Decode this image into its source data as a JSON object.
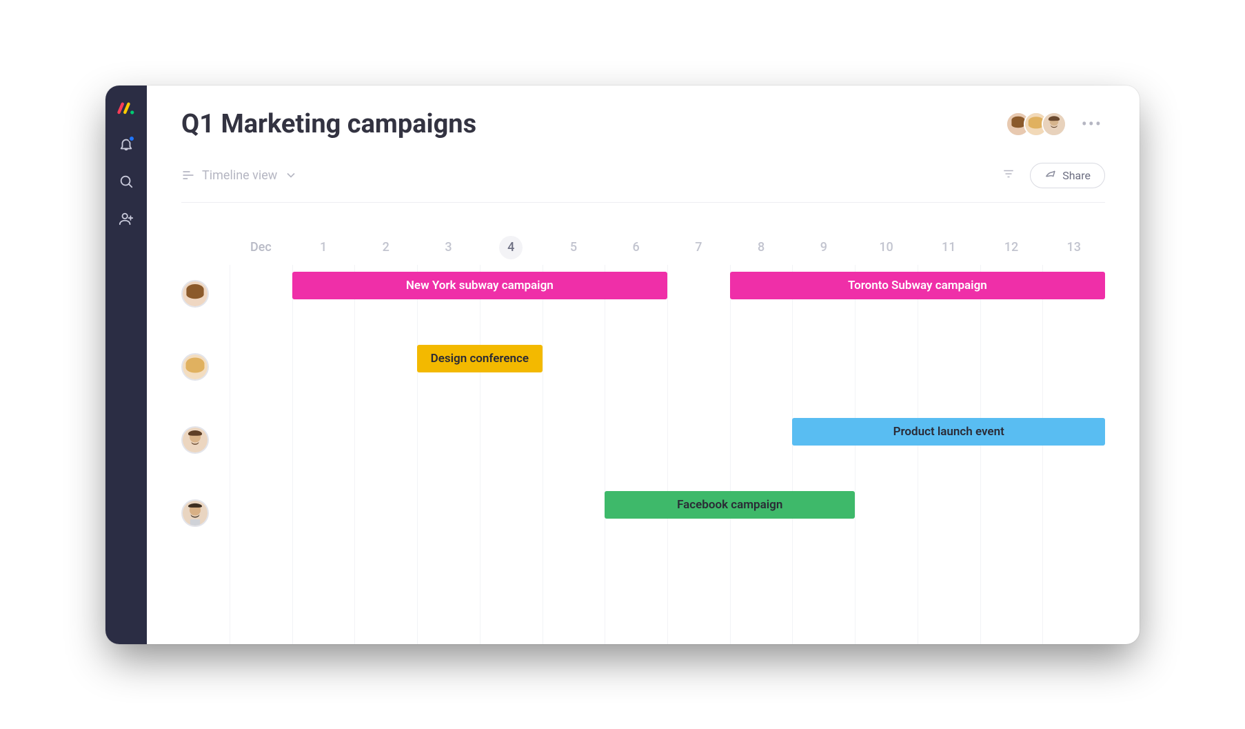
{
  "header": {
    "title": "Q1 Marketing campaigns",
    "share_label": "Share",
    "view_label": "Timeline view"
  },
  "timeline": {
    "month_label": "Dec",
    "days": [
      "1",
      "2",
      "3",
      "4",
      "5",
      "6",
      "7",
      "8",
      "9",
      "10",
      "11",
      "12",
      "13"
    ],
    "today_index": 3,
    "colors": {
      "pink": "#ef2fa8",
      "yellow": "#f3b900",
      "blue": "#59bdf2",
      "green": "#3eb96a"
    },
    "rows": [
      {
        "person": "user-1",
        "bars": [
          {
            "label": "New York subway campaign",
            "color": "pink",
            "start": 0,
            "span": 6
          },
          {
            "label": "Toronto Subway campaign",
            "color": "pink",
            "start": 7,
            "span": 6
          }
        ]
      },
      {
        "person": "user-2",
        "bars": [
          {
            "label": "Design conference",
            "color": "yellow",
            "start": 2,
            "span": 2
          }
        ]
      },
      {
        "person": "user-3",
        "bars": [
          {
            "label": "Product launch event",
            "color": "blue",
            "start": 8,
            "span": 5
          }
        ]
      },
      {
        "person": "user-4",
        "bars": [
          {
            "label": "Facebook campaign",
            "color": "green",
            "start": 5,
            "span": 4
          }
        ]
      }
    ]
  },
  "chart_data": {
    "type": "gantt",
    "title": "Q1 Marketing campaigns",
    "x_unit": "day",
    "x_month": "Dec",
    "x_values": [
      1,
      2,
      3,
      4,
      5,
      6,
      7,
      8,
      9,
      10,
      11,
      12,
      13
    ],
    "today": 4,
    "series": [
      {
        "row": 0,
        "name": "New York subway campaign",
        "owner": "user-1",
        "start": 1,
        "end": 6,
        "color": "#ef2fa8"
      },
      {
        "row": 0,
        "name": "Toronto Subway campaign",
        "owner": "user-1",
        "start": 8,
        "end": 13,
        "color": "#ef2fa8"
      },
      {
        "row": 1,
        "name": "Design conference",
        "owner": "user-2",
        "start": 3,
        "end": 4,
        "color": "#f3b900"
      },
      {
        "row": 2,
        "name": "Product launch event",
        "owner": "user-3",
        "start": 9,
        "end": 13,
        "color": "#59bdf2"
      },
      {
        "row": 3,
        "name": "Facebook campaign",
        "owner": "user-4",
        "start": 6,
        "end": 9,
        "color": "#3eb96a"
      }
    ]
  }
}
